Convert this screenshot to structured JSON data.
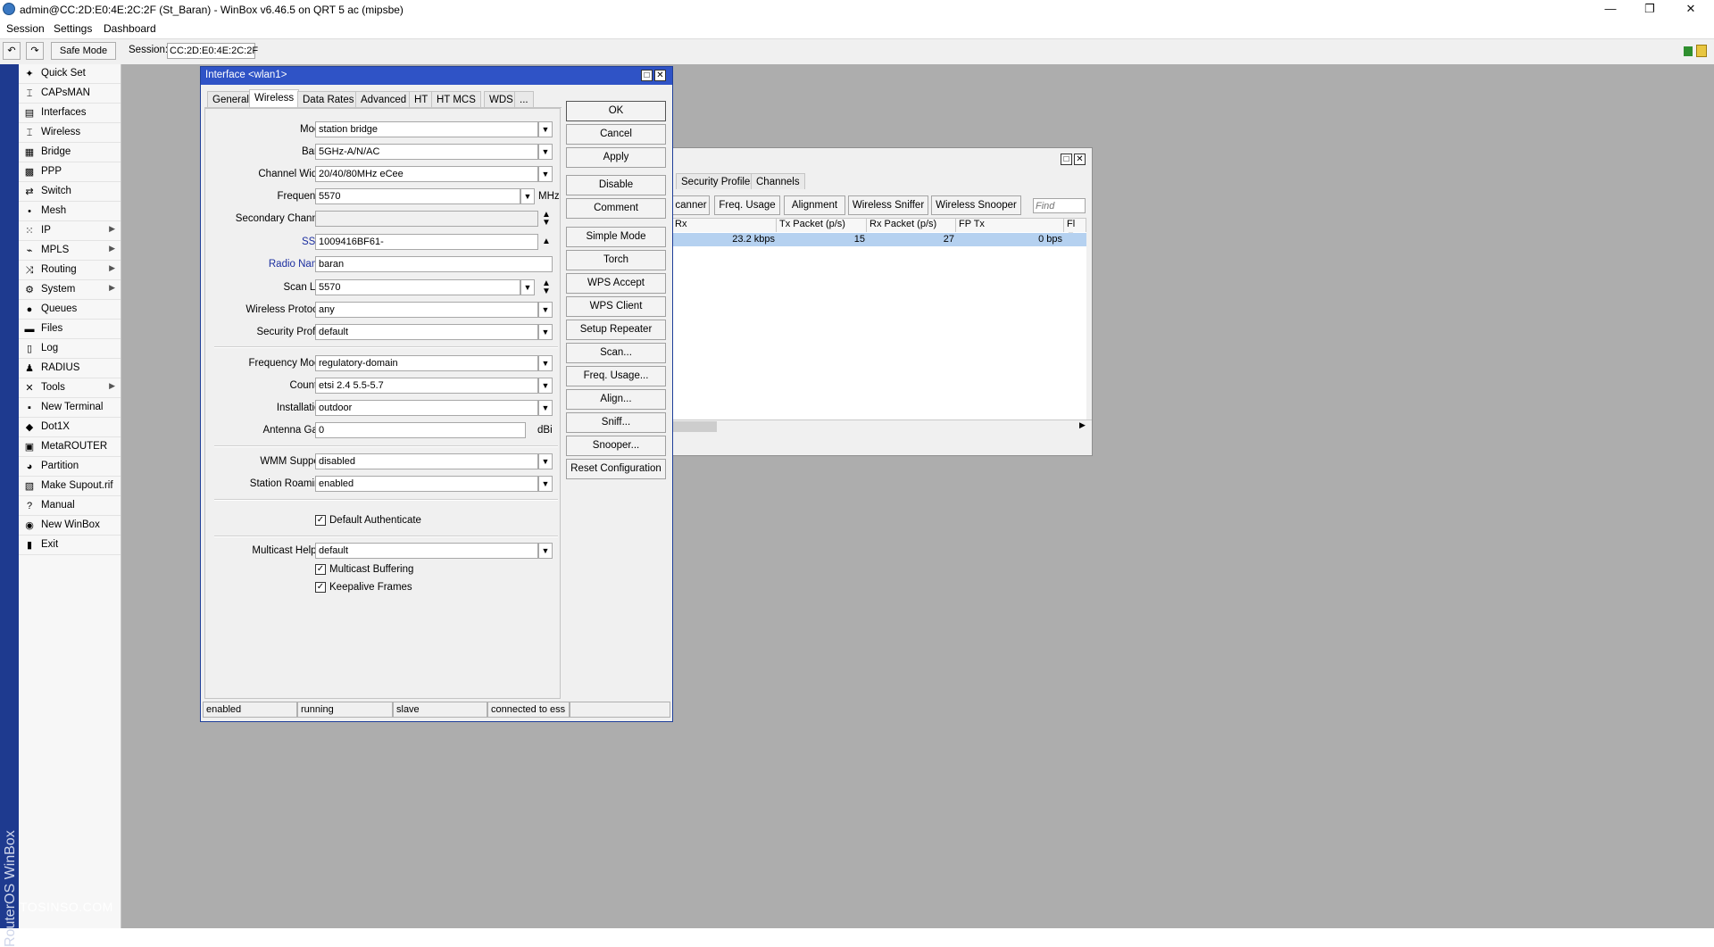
{
  "app": {
    "title": "admin@CC:2D:E0:4E:2C:2F (St_Baran) - WinBox v6.46.5 on QRT 5 ac (mipsbe)",
    "menu": [
      "Session",
      "Settings",
      "Dashboard"
    ],
    "toolbar": {
      "undo": "↶",
      "redo": "↷",
      "safe_mode": "Safe Mode",
      "session_label": "Session:",
      "session_value": "CC:2D:E0:4E:2C:2F"
    },
    "vertical_brand": "RouterOS WinBox",
    "watermark": "TOSINSO.COM",
    "colors": {
      "accent": "#2f53c6",
      "sidebar_strip": "#1e3a8f",
      "selected_row": "#b5d1f0",
      "desktop": "#adadad"
    }
  },
  "sidebar": {
    "items": [
      {
        "label": "Quick Set",
        "icon": "quick-set-icon",
        "glyph": "✦",
        "arrow": false
      },
      {
        "label": "CAPsMAN",
        "icon": "capsman-icon",
        "glyph": "⌶",
        "arrow": false
      },
      {
        "label": "Interfaces",
        "icon": "interfaces-icon",
        "glyph": "▤",
        "arrow": false
      },
      {
        "label": "Wireless",
        "icon": "wireless-icon",
        "glyph": "⌶",
        "arrow": false
      },
      {
        "label": "Bridge",
        "icon": "bridge-icon",
        "glyph": "▦",
        "arrow": false
      },
      {
        "label": "PPP",
        "icon": "ppp-icon",
        "glyph": "▩",
        "arrow": false
      },
      {
        "label": "Switch",
        "icon": "switch-icon",
        "glyph": "⇄",
        "arrow": false
      },
      {
        "label": "Mesh",
        "icon": "mesh-icon",
        "glyph": "•",
        "arrow": false
      },
      {
        "label": "IP",
        "icon": "ip-icon",
        "glyph": "⁙",
        "arrow": true
      },
      {
        "label": "MPLS",
        "icon": "mpls-icon",
        "glyph": "⌁",
        "arrow": true
      },
      {
        "label": "Routing",
        "icon": "routing-icon",
        "glyph": "⤨",
        "arrow": true
      },
      {
        "label": "System",
        "icon": "system-icon",
        "glyph": "⚙",
        "arrow": true
      },
      {
        "label": "Queues",
        "icon": "queues-icon",
        "glyph": "●",
        "arrow": false
      },
      {
        "label": "Files",
        "icon": "files-icon",
        "glyph": "▬",
        "arrow": false
      },
      {
        "label": "Log",
        "icon": "log-icon",
        "glyph": "▯",
        "arrow": false
      },
      {
        "label": "RADIUS",
        "icon": "radius-icon",
        "glyph": "♟",
        "arrow": false
      },
      {
        "label": "Tools",
        "icon": "tools-icon",
        "glyph": "✕",
        "arrow": true
      },
      {
        "label": "New Terminal",
        "icon": "terminal-icon",
        "glyph": "▪",
        "arrow": false
      },
      {
        "label": "Dot1X",
        "icon": "dot1x-icon",
        "glyph": "◆",
        "arrow": false
      },
      {
        "label": "MetaROUTER",
        "icon": "metarouter-icon",
        "glyph": "▣",
        "arrow": false
      },
      {
        "label": "Partition",
        "icon": "partition-icon",
        "glyph": "◕",
        "arrow": false
      },
      {
        "label": "Make Supout.rif",
        "icon": "supout-icon",
        "glyph": "▧",
        "arrow": false
      },
      {
        "label": "Manual",
        "icon": "manual-icon",
        "glyph": "?",
        "arrow": false
      },
      {
        "label": "New WinBox",
        "icon": "winbox-icon",
        "glyph": "◉",
        "arrow": false
      },
      {
        "label": "Exit",
        "icon": "exit-icon",
        "glyph": "▮",
        "arrow": false
      }
    ]
  },
  "bg_window": {
    "tabs": [
      "Security Profiles",
      "Channels"
    ],
    "buttons": [
      "canner",
      "Freq. Usage",
      "Alignment",
      "Wireless Sniffer",
      "Wireless Snooper"
    ],
    "find_placeholder": "Find",
    "columns": [
      "Rx",
      "Tx Packet (p/s)",
      "Rx Packet (p/s)",
      "FP Tx",
      "Fl"
    ],
    "row": [
      "23.2 kbps",
      "15",
      "27",
      "0 bps"
    ]
  },
  "dialog": {
    "title": "Interface <wlan1>",
    "tabs": [
      "General",
      "Wireless",
      "Data Rates",
      "Advanced",
      "HT",
      "HT MCS",
      "WDS",
      "..."
    ],
    "fields": {
      "mode": {
        "label": "Mode:",
        "value": "station bridge"
      },
      "band": {
        "label": "Band:",
        "value": "5GHz-A/N/AC"
      },
      "channel_width": {
        "label": "Channel Width:",
        "value": "20/40/80MHz eCee"
      },
      "frequency": {
        "label": "Frequency:",
        "value": "5570",
        "unit": "MHz"
      },
      "secondary_channel": {
        "label": "Secondary Channel:",
        "value": ""
      },
      "ssid": {
        "label": "SSID:",
        "value": "1009416BF61-"
      },
      "radio_name": {
        "label": "Radio Name:",
        "value": "baran"
      },
      "scan_list": {
        "label": "Scan List:",
        "value": "5570"
      },
      "wireless_protocol": {
        "label": "Wireless Protocol:",
        "value": "any"
      },
      "security_profile": {
        "label": "Security Profile:",
        "value": "default"
      },
      "frequency_mode": {
        "label": "Frequency Mode:",
        "value": "regulatory-domain"
      },
      "country": {
        "label": "Country:",
        "value": "etsi 2.4 5.5-5.7"
      },
      "installation": {
        "label": "Installation:",
        "value": "outdoor"
      },
      "antenna_gain": {
        "label": "Antenna Gain:",
        "value": "0",
        "unit": "dBi"
      },
      "wmm_support": {
        "label": "WMM Support:",
        "value": "disabled"
      },
      "station_roaming": {
        "label": "Station Roaming:",
        "value": "enabled"
      },
      "multicast_helper": {
        "label": "Multicast Helper:",
        "value": "default"
      }
    },
    "checkboxes": {
      "default_authenticate": {
        "label": "Default Authenticate",
        "checked": true
      },
      "multicast_buffering": {
        "label": "Multicast Buffering",
        "checked": true
      },
      "keepalive_frames": {
        "label": "Keepalive Frames",
        "checked": true
      }
    },
    "buttons": [
      "OK",
      "Cancel",
      "Apply",
      "Disable",
      "Comment",
      "Simple Mode",
      "Torch",
      "WPS Accept",
      "WPS Client",
      "Setup Repeater",
      "Scan...",
      "Freq. Usage...",
      "Align...",
      "Sniff...",
      "Snooper...",
      "Reset Configuration"
    ],
    "status": [
      "enabled",
      "running",
      "slave",
      "connected to ess"
    ]
  }
}
